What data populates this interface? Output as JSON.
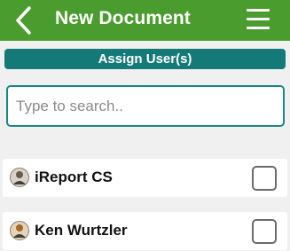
{
  "header": {
    "title": "New Document",
    "back_icon": "chevron-left-icon",
    "menu_icon": "hamburger-menu-icon",
    "color": "#4a9c2e"
  },
  "section": {
    "title": "Assign User(s)",
    "color": "#137a78"
  },
  "search": {
    "placeholder": "Type to search..",
    "value": ""
  },
  "users": [
    {
      "name": "iReport CS",
      "avatar": "user-avatar-icon",
      "checked": false
    },
    {
      "name": "Ken Wurtzler",
      "avatar": "user-avatar-icon",
      "checked": false
    }
  ]
}
